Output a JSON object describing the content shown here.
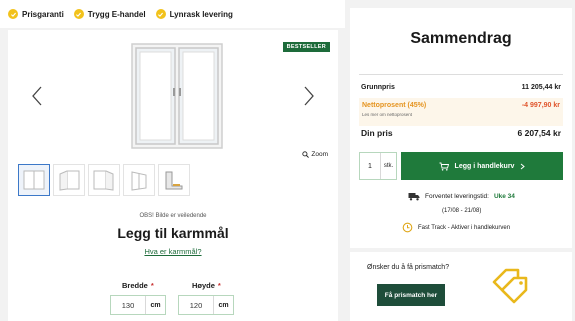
{
  "trust": {
    "items": [
      {
        "label": "Prisgaranti",
        "icon": "check-icon"
      },
      {
        "label": "Trygg E-handel",
        "icon": "check-icon"
      },
      {
        "label": "Lynrask levering",
        "icon": "check-icon"
      }
    ],
    "accent": "#f2c21b"
  },
  "product": {
    "badge": "BESTSELLER",
    "zoom_label": "Zoom",
    "image_note": "OBS! Bilde er veiledende",
    "heading": "Legg til karmmål",
    "help_link": "Hva er karmmål?",
    "width": {
      "label": "Bredde",
      "required_mark": "*",
      "value": "130",
      "unit": "cm"
    },
    "height": {
      "label": "Høyde",
      "required_mark": "*",
      "value": "120",
      "unit": "cm"
    }
  },
  "summary": {
    "title": "Sammendrag",
    "base_price": {
      "label": "Grunnpris",
      "value": "11 205,44 kr"
    },
    "discount": {
      "label": "Nettoprosent (45%)",
      "value": "-4 997,90 kr",
      "sub": "Les mer om nettoprosent"
    },
    "your_price": {
      "label": "Din pris",
      "value": "6 207,54 kr"
    },
    "quantity": {
      "value": "1",
      "unit": "stk."
    },
    "cart_button": "Legg i handlekurv",
    "delivery": {
      "label": "Forventet leveringstid:",
      "week": "Uke  34",
      "dates": "(17/08 - 21/08)"
    },
    "fast_track": "Fast Track - Aktiver i handlekurven"
  },
  "price_match": {
    "question": "Ønsker du å få prismatch?",
    "button": "Få prismatch her"
  },
  "colors": {
    "brand_green": "#1f7a3b",
    "dark_green": "#1e4d3a",
    "discount_orange": "#e59420",
    "discount_red": "#e0552c"
  }
}
